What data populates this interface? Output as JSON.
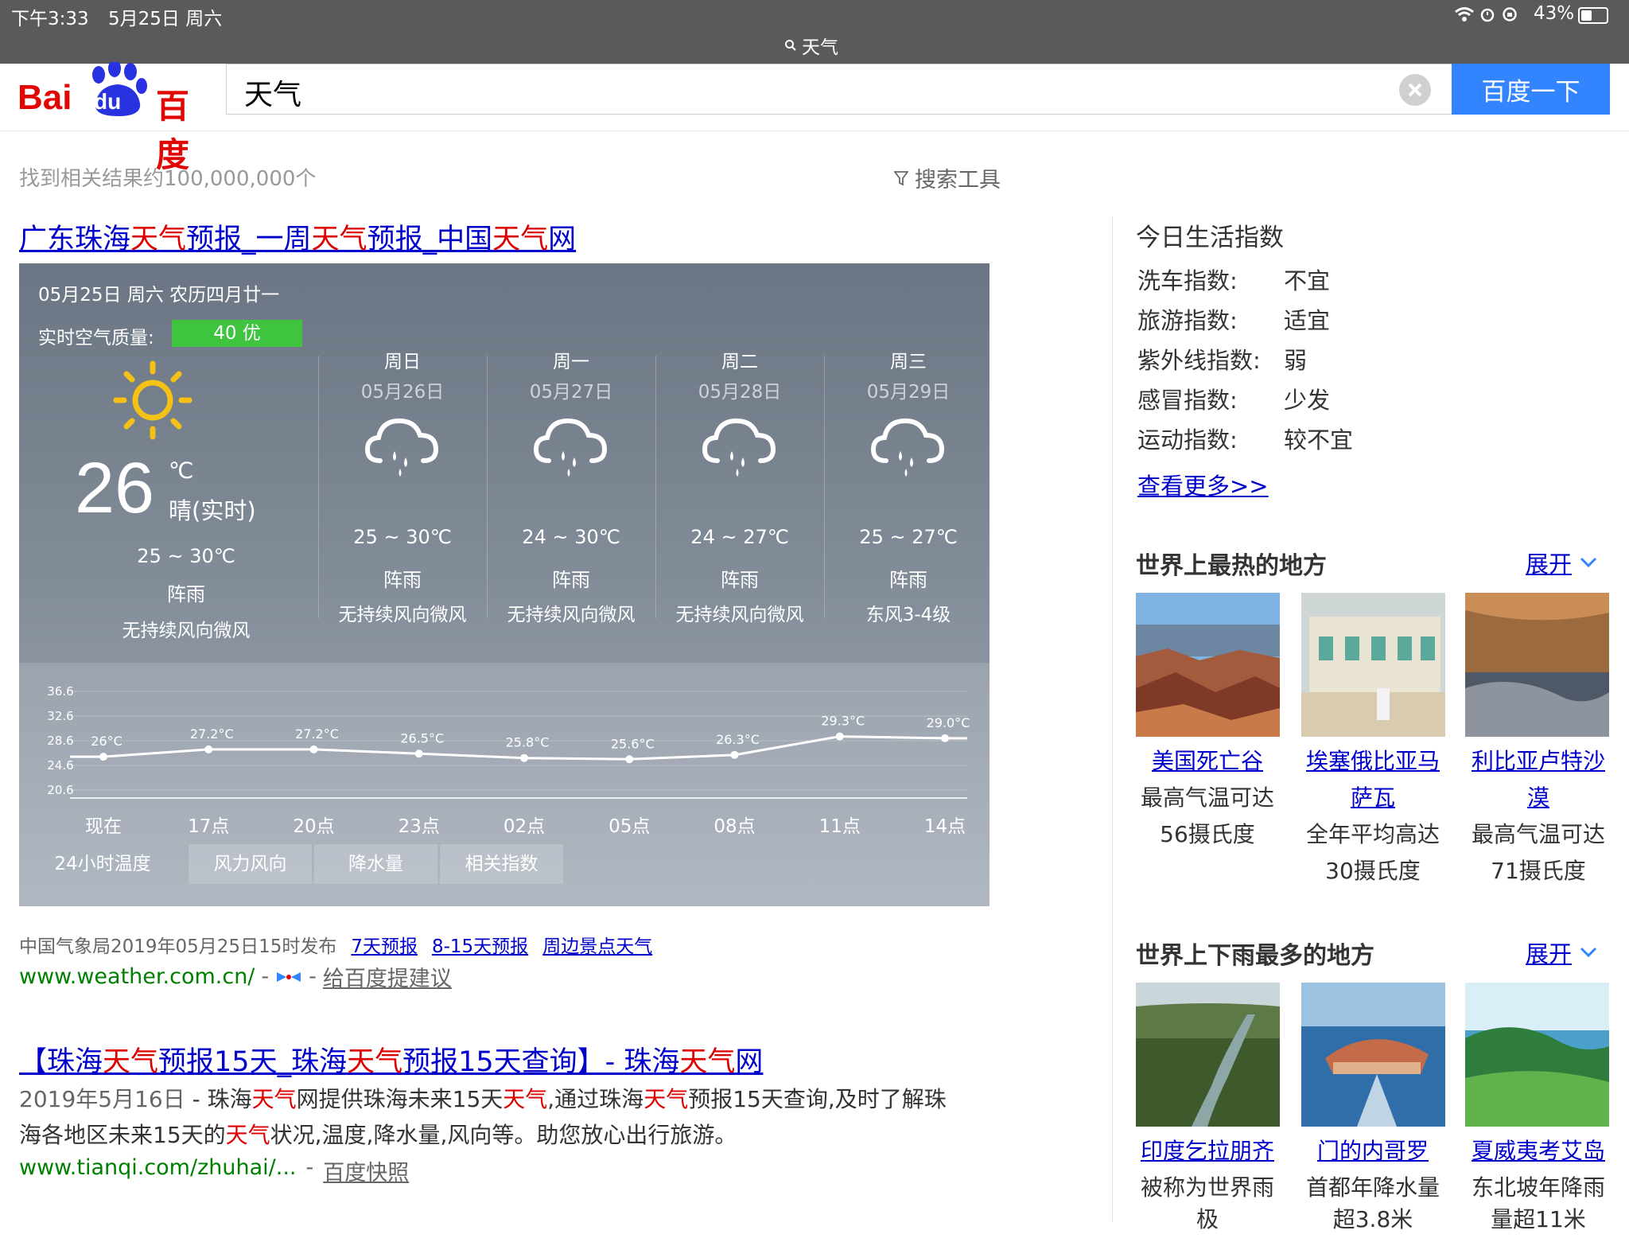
{
  "status_bar": {
    "time": "下午3:33",
    "date": "5月25日 周六",
    "url": "天气",
    "battery": "43%"
  },
  "header": {
    "logo_bai": "Bai",
    "logo_du": "du",
    "logo_cn": "百度",
    "query": "天气",
    "search_button": "百度一下"
  },
  "results_meta": {
    "count": "找到相关结果约100,000,000个",
    "tools": "搜索工具"
  },
  "result1": {
    "title_parts": [
      "广东珠海",
      "天气",
      "预报_一周",
      "天气",
      "预报_中国",
      "天气",
      "网"
    ],
    "source": "中国气象局2019年05月25日15时发布",
    "links": [
      "7天预报",
      "8-15天预报",
      "周边景点天气"
    ],
    "url": "www.weather.com.cn/",
    "url_sep": "-",
    "suggest": "给百度提建议"
  },
  "weather": {
    "date_line": "05月25日 周六 农历四月廿一",
    "aqi_label": "实时空气质量:",
    "aqi_value": "40 优",
    "now_temp": "26",
    "now_unit": "℃",
    "now_cond": "晴(实时)",
    "today": {
      "range": "25 ~ 30℃",
      "cond": "阵雨",
      "wind": "无持续风向微风"
    },
    "days": [
      {
        "day": "周日",
        "date": "05月26日",
        "range": "25 ~ 30℃",
        "cond": "阵雨",
        "wind": "无持续风向微风"
      },
      {
        "day": "周一",
        "date": "05月27日",
        "range": "24 ~ 30℃",
        "cond": "阵雨",
        "wind": "无持续风向微风"
      },
      {
        "day": "周二",
        "date": "05月28日",
        "range": "24 ~ 27℃",
        "cond": "阵雨",
        "wind": "无持续风向微风"
      },
      {
        "day": "周三",
        "date": "05月29日",
        "range": "25 ~ 27℃",
        "cond": "阵雨",
        "wind": "东风3-4级"
      }
    ],
    "tabs": [
      "24小时温度",
      "风力风向",
      "降水量",
      "相关指数"
    ]
  },
  "chart_data": {
    "type": "line",
    "title": "",
    "xlabel": "",
    "ylabel": "",
    "y_ticks": [
      "36.6",
      "32.6",
      "28.6",
      "24.6",
      "20.6"
    ],
    "ylim": [
      20.6,
      36.6
    ],
    "categories": [
      "现在",
      "17点",
      "20点",
      "23点",
      "02点",
      "05点",
      "08点",
      "11点",
      "14点"
    ],
    "values": [
      26.0,
      27.2,
      27.2,
      26.5,
      25.8,
      25.6,
      26.3,
      29.3,
      29.0
    ],
    "labels": [
      "26°C",
      "27.2°C",
      "27.2°C",
      "26.5°C",
      "25.8°C",
      "25.6°C",
      "26.3°C",
      "29.3°C",
      "29.0°C"
    ],
    "grid": true,
    "legend": "none"
  },
  "result2": {
    "title_parts": [
      "【珠海",
      "天气",
      "预报15天_珠海",
      "天气",
      "预报15天查询】- 珠海",
      "天气",
      "网"
    ],
    "date": "2019年5月16日",
    "snippet1_parts": [
      " - 珠海",
      "天气",
      "网提供珠海未来15天",
      "天气",
      ",通过珠海",
      "天气",
      "预报15天查询,及时了解珠"
    ],
    "snippet2_parts": [
      "海各地区未来15天的",
      "天气",
      "状况,温度,降水量,风向等。助您放心出行旅游。"
    ],
    "url": "www.tianqi.com/zhuhai/...",
    "url_sep": "-",
    "snapshot": "百度快照"
  },
  "sidebar": {
    "life_title": "今日生活指数",
    "life": [
      {
        "k": "洗车指数:",
        "v": "不宜"
      },
      {
        "k": "旅游指数:",
        "v": "适宜"
      },
      {
        "k": "紫外线指数:",
        "v": "弱"
      },
      {
        "k": "感冒指数:",
        "v": "少发"
      },
      {
        "k": "运动指数:",
        "v": "较不宜"
      }
    ],
    "more": "查看更多>>",
    "hot_title": "世界上最热的地方",
    "expand": "展开",
    "hot": [
      {
        "name1": "美国死亡谷",
        "name2": "",
        "d1": "最高气温可达",
        "d2": "56摄氏度"
      },
      {
        "name1": "埃塞俄比亚马",
        "name2": "萨瓦",
        "d1": "全年平均高达",
        "d2": "30摄氏度"
      },
      {
        "name1": "利比亚卢特沙",
        "name2": "漠",
        "d1": "最高气温可达",
        "d2": "71摄氏度"
      }
    ],
    "rain_title": "世界上下雨最多的地方",
    "rain": [
      {
        "name": "印度乞拉朋齐",
        "d1": "被称为世界雨",
        "d2": "极"
      },
      {
        "name": "门的内哥罗",
        "d1": "首都年降水量",
        "d2": "超3.8米"
      },
      {
        "name": "夏威夷考艾岛",
        "d1": "东北坡年降雨",
        "d2": "量超11米"
      }
    ]
  }
}
